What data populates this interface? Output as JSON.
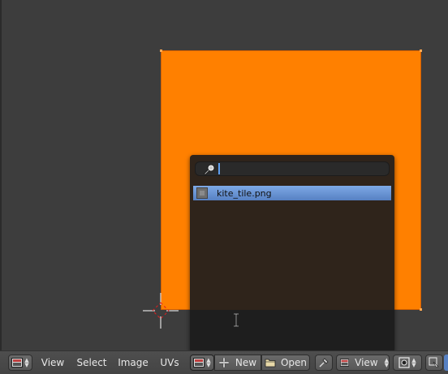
{
  "menu": {
    "view": "View",
    "select": "Select",
    "image": "Image",
    "uvs": "UVs"
  },
  "image_block": {
    "new_label": "New",
    "open_label": "Open"
  },
  "view_dropdown": {
    "selected": "View"
  },
  "search": {
    "value": "",
    "results": [
      "kite_tile.png"
    ]
  },
  "colors": {
    "image_fill": "#ff8000",
    "viewport_bg": "#3d3d3d",
    "highlight": "#5680c2",
    "popup_bg": "#2f241b"
  },
  "icons": {
    "editor_type": "image-editor-icon",
    "browse": "image-browse-icon",
    "new": "plus-icon",
    "open": "folder-icon",
    "pin": "pin-icon",
    "search": "magnifier-icon",
    "snap": "pivot-icon"
  }
}
